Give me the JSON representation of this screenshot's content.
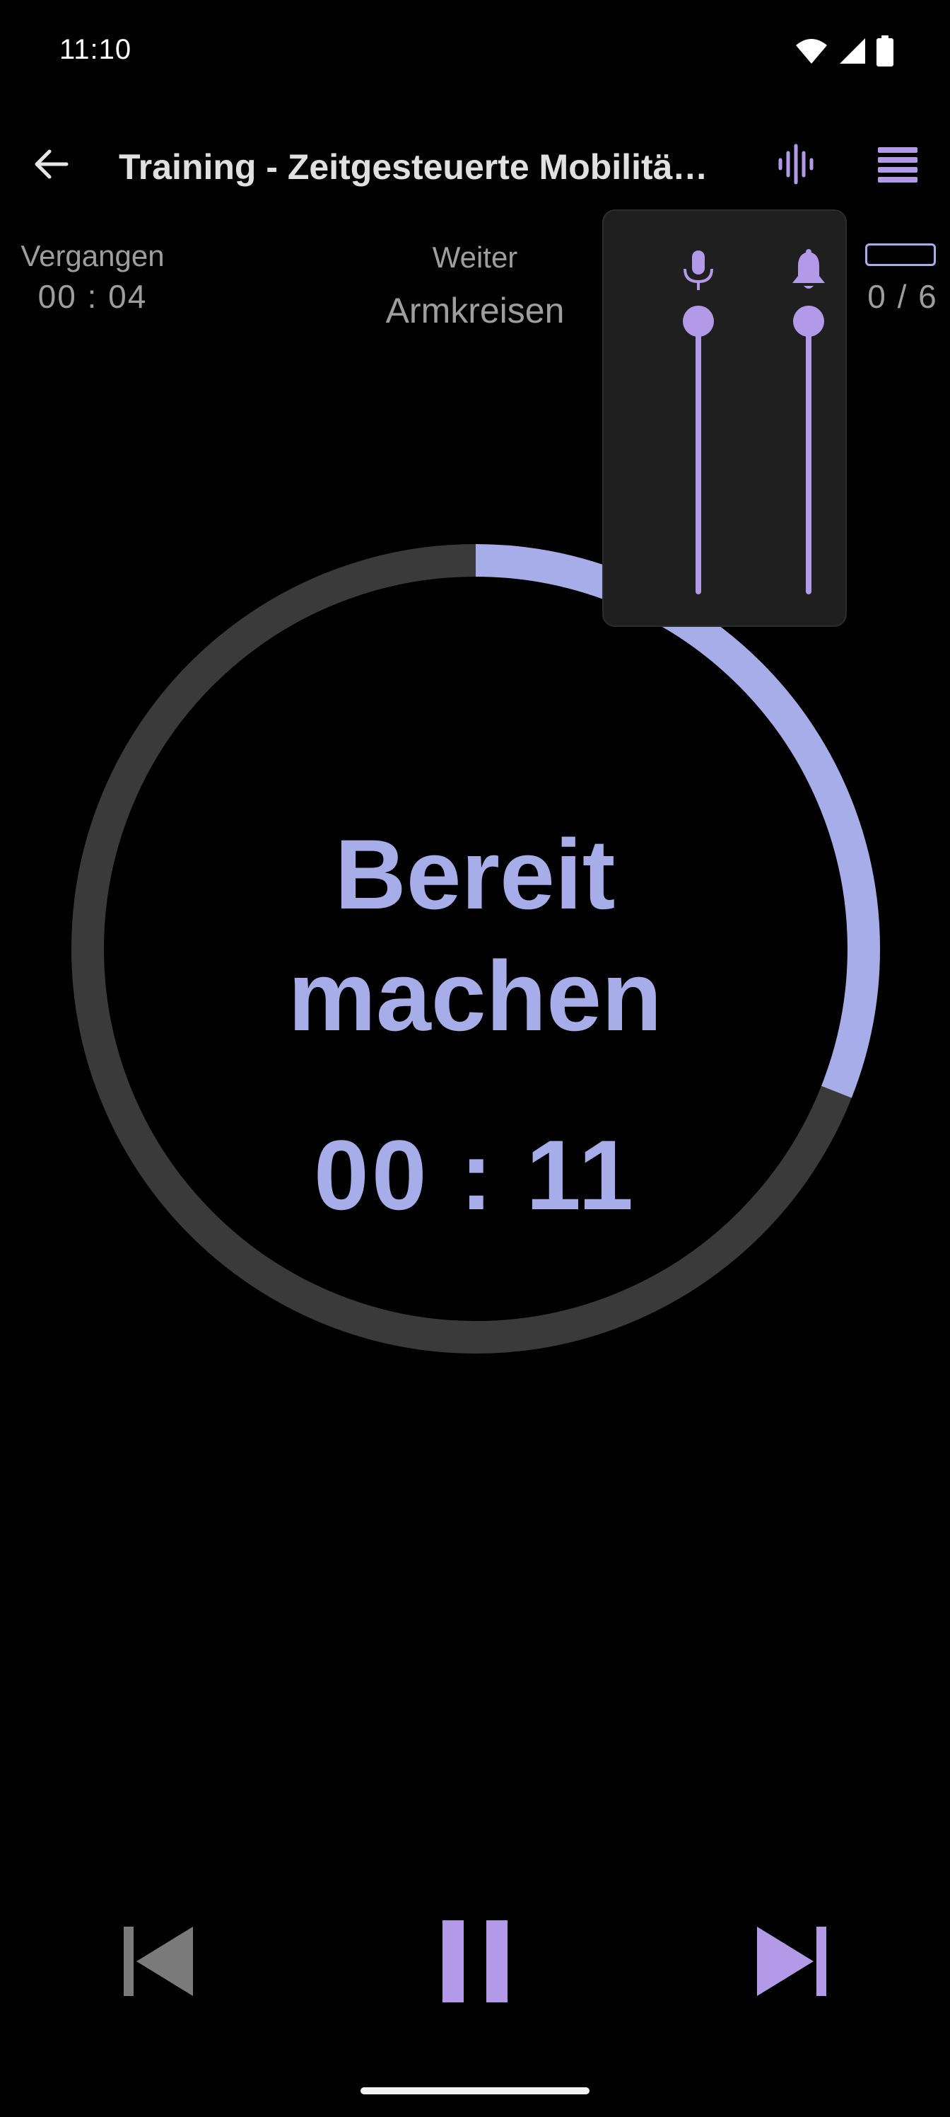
{
  "status_bar": {
    "time": "11:10",
    "icons": [
      "wifi-icon",
      "signal-icon",
      "battery-icon"
    ]
  },
  "app_bar": {
    "title": "Training - Zeitgesteuerte Mobilitä…",
    "back_icon": "arrow-left-icon",
    "sound_icon": "waveform-icon",
    "menu_icon": "list-icon"
  },
  "info": {
    "elapsed_label": "Vergangen",
    "elapsed_value": "00 : 04",
    "next_label": "Weiter",
    "next_value": "Armkreisen",
    "rounds_value": "0 / 6"
  },
  "phase": {
    "line1": "Bereit",
    "line2": "machen",
    "timer": "00 : 11",
    "ring_progress": 0.31
  },
  "volume_popup": {
    "voice_icon": "microphone-icon",
    "bell_icon": "bell-icon",
    "voice_level": 1.0,
    "bell_level": 1.0
  },
  "controls": {
    "prev_icon": "skip-previous-icon",
    "pause_icon": "pause-icon",
    "next_icon": "skip-next-icon"
  },
  "colors": {
    "accent": "#a6ade9",
    "accent_purple": "#b29ae8",
    "ring_track": "#3a3a3a",
    "background": "#000000",
    "popup_bg": "#1f1f1f",
    "muted_text": "#9e9e9e"
  }
}
